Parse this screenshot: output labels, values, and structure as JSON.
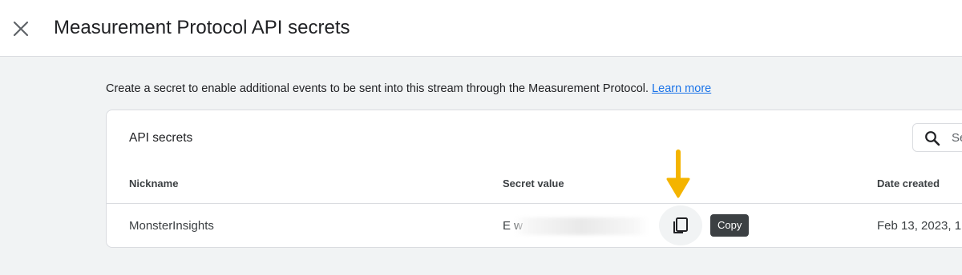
{
  "header": {
    "title": "Measurement Protocol API secrets",
    "close_icon": "close-icon"
  },
  "description": {
    "text": "Create a secret to enable additional events to be sent into this stream through the Measurement Protocol.",
    "link_text": "Learn more"
  },
  "card": {
    "title": "API secrets",
    "search": {
      "placeholder": "Se",
      "icon": "search-icon"
    },
    "columns": [
      "Nickname",
      "Secret value",
      "Date created"
    ],
    "rows": [
      {
        "nickname": "MonsterInsights",
        "secret_value_visible": "E                                               w",
        "date_created": "Feb 13, 2023, 1"
      }
    ],
    "copy_icon": "copy-icon",
    "copy_tooltip": "Copy"
  },
  "colors": {
    "link": "#1a73e8",
    "tooltip_bg": "#3c4043",
    "annotation_arrow": "#f4b400",
    "page_bg": "#f1f3f4"
  }
}
